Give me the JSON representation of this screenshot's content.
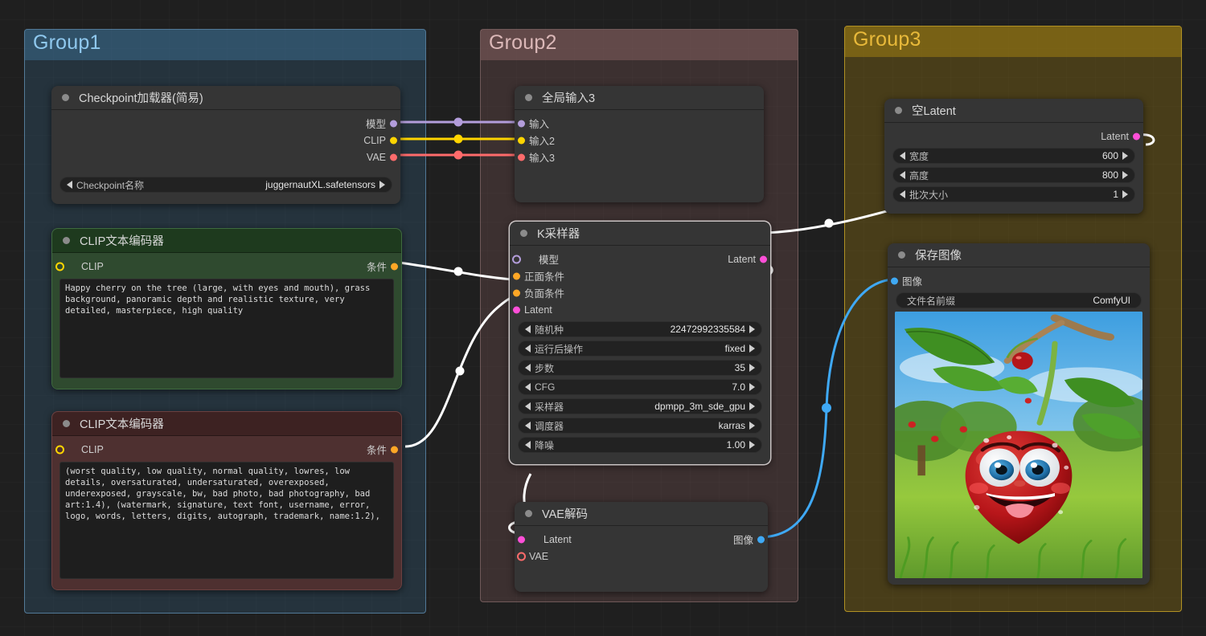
{
  "groups": [
    {
      "id": "group1",
      "title": "Group1",
      "color": "#8fc8ee"
    },
    {
      "id": "group2",
      "title": "Group2",
      "color": "#dbb8b8"
    },
    {
      "id": "group3",
      "title": "Group3",
      "color": "#e8b93a"
    }
  ],
  "nodes": {
    "checkpoint_loader": {
      "title": "Checkpoint加载器(简易)",
      "outputs": [
        {
          "name": "模型",
          "color": "#b39ddb"
        },
        {
          "name": "CLIP",
          "color": "#ffd500"
        },
        {
          "name": "VAE",
          "color": "#ff6b6b"
        }
      ],
      "widgets": [
        {
          "name": "Checkpoint名称",
          "value": "juggernautXL.safetensors"
        }
      ]
    },
    "clip_positive": {
      "title": "CLIP文本编码器",
      "input": {
        "name": "CLIP",
        "color": "#ffd500"
      },
      "output": {
        "name": "条件",
        "color": "#ffa726"
      },
      "text": "Happy cherry on the tree (large, with eyes and mouth), grass background, panoramic depth and realistic texture, very detailed, masterpiece, high quality"
    },
    "clip_negative": {
      "title": "CLIP文本编码器",
      "input": {
        "name": "CLIP",
        "color": "#ffd500"
      },
      "output": {
        "name": "条件",
        "color": "#ffa726"
      },
      "text": "(worst quality, low quality, normal quality, lowres, low details, oversaturated, undersaturated, overexposed, underexposed, grayscale, bw, bad photo, bad photography, bad art:1.4), (watermark, signature, text font, username, error, logo, words, letters, digits, autograph, trademark, name:1.2),"
    },
    "global_input": {
      "title": "全局输入3",
      "inputs": [
        {
          "name": "输入",
          "color": "#b39ddb"
        },
        {
          "name": "输入2",
          "color": "#ffd500"
        },
        {
          "name": "输入3",
          "color": "#ff6b6b"
        }
      ]
    },
    "ksampler": {
      "title": "K采样器",
      "inputs": [
        {
          "name": "模型",
          "color": "#b39ddb",
          "ring": true
        },
        {
          "name": "正面条件",
          "color": "#ffa726"
        },
        {
          "name": "负面条件",
          "color": "#ffa726"
        },
        {
          "name": "Latent",
          "color": "#ff4fd8"
        }
      ],
      "outputs": [
        {
          "name": "Latent",
          "color": "#ff4fd8"
        }
      ],
      "widgets": [
        {
          "name": "随机种",
          "value": "22472992335584"
        },
        {
          "name": "运行后操作",
          "value": "fixed"
        },
        {
          "name": "步数",
          "value": "35"
        },
        {
          "name": "CFG",
          "value": "7.0"
        },
        {
          "name": "采样器",
          "value": "dpmpp_3m_sde_gpu"
        },
        {
          "name": "调度器",
          "value": "karras"
        },
        {
          "name": "降噪",
          "value": "1.00"
        }
      ]
    },
    "vae_decode": {
      "title": "VAE解码",
      "inputs": [
        {
          "name": "Latent",
          "color": "#ff4fd8"
        },
        {
          "name": "VAE",
          "color": "#ff6b6b",
          "ring": true
        }
      ],
      "outputs": [
        {
          "name": "图像",
          "color": "#3fa9f5"
        }
      ]
    },
    "empty_latent": {
      "title": "空Latent",
      "outputs": [
        {
          "name": "Latent",
          "color": "#ff4fd8"
        }
      ],
      "widgets": [
        {
          "name": "宽度",
          "value": "600"
        },
        {
          "name": "高度",
          "value": "800"
        },
        {
          "name": "批次大小",
          "value": "1"
        }
      ]
    },
    "save_image": {
      "title": "保存图像",
      "inputs": [
        {
          "name": "图像",
          "color": "#3fa9f5"
        }
      ],
      "widgets": [
        {
          "name": "文件名前缀",
          "value": "ComfyUI"
        }
      ]
    }
  },
  "colors": {
    "model_link": "#b39ddb",
    "clip_link": "#ffd500",
    "vae_link": "#ff6b6b",
    "cond_link": "#ffffff",
    "latent_link": "#ffffff",
    "image_link": "#3fa9f5",
    "group1": "#8fc8ee",
    "group2": "#dbb8b8",
    "group3": "#e8b93a"
  }
}
